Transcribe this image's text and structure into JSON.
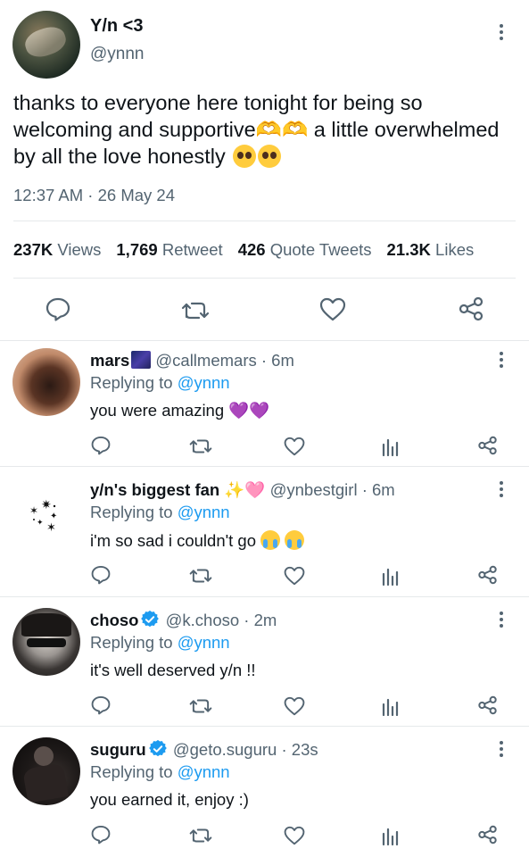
{
  "main_tweet": {
    "display_name": "Y/n <3",
    "handle": "@ynnn",
    "text_part1": "thanks to everyone here tonight for being so welcoming and supportive",
    "text_emoji1": "🫶🫶",
    "text_part2": " a little overwhelmed by all the love honestly ",
    "timestamp": "12:37 AM · 26 May 24",
    "stats": {
      "views_count": "237K",
      "views_label": "Views",
      "retweet_count": "1,769",
      "retweet_label": "Retweet",
      "quote_count": "426",
      "quote_label": "Quote Tweets",
      "likes_count": "21.3K",
      "likes_label": "Likes"
    }
  },
  "replies": [
    {
      "display_name": "mars",
      "handle_time": "@callmemars · 6m",
      "replying_prefix": "Replying to ",
      "replying_handle": "@ynnn",
      "text": "you were amazing ",
      "emoji": "💜💜"
    },
    {
      "display_name": "y/n's biggest fan",
      "name_emoji_1": "✨",
      "name_emoji_2": "🩷",
      "handle_time": "@ynbestgirl · 6m",
      "replying_prefix": "Replying to ",
      "replying_handle": "@ynnn",
      "text": "i'm so sad i couldn't go "
    },
    {
      "display_name": "choso",
      "handle_time": "@k.choso · 2m",
      "replying_prefix": "Replying to ",
      "replying_handle": "@ynnn",
      "text": "it's well deserved y/n !!"
    },
    {
      "display_name": "suguru",
      "handle_time": "@geto.suguru · 23s",
      "replying_prefix": "Replying to ",
      "replying_handle": "@ynnn",
      "text": "you earned it, enjoy :)"
    }
  ],
  "icons": {
    "reply": "reply-icon",
    "retweet": "retweet-icon",
    "like": "heart-icon",
    "views": "views-icon",
    "share": "share-icon",
    "more": "more-icon",
    "verified": "verified-icon"
  },
  "colors": {
    "link": "#1d9bf0",
    "secondary_text": "#536471",
    "verified": "#1d9bf0"
  }
}
